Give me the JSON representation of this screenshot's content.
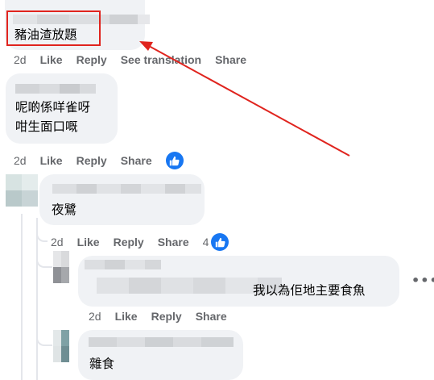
{
  "comments": [
    {
      "text": "豬油渣放題"
    },
    {
      "lines": [
        "呢啲係咩雀呀",
        "咁生面口嘅"
      ]
    },
    {
      "text": "夜鷺"
    },
    {
      "text": "我以為佢地主要食魚"
    },
    {
      "text": "雜食"
    }
  ],
  "actions": {
    "time": "2d",
    "like": "Like",
    "reply": "Reply",
    "share": "Share",
    "see_translation": "See translation"
  },
  "reactions": {
    "comment2_count": "",
    "reply2_count": "4"
  },
  "annotation": {
    "box_color": "#e0241e",
    "arrow_color": "#e0241e"
  },
  "icons": {
    "like_reaction": "thumbs-up-icon",
    "more_options": "more-options-icon"
  },
  "colors": {
    "bubble": "#f0f2f5",
    "meta_text": "#65676b",
    "reaction_blue": "#1877f2"
  }
}
